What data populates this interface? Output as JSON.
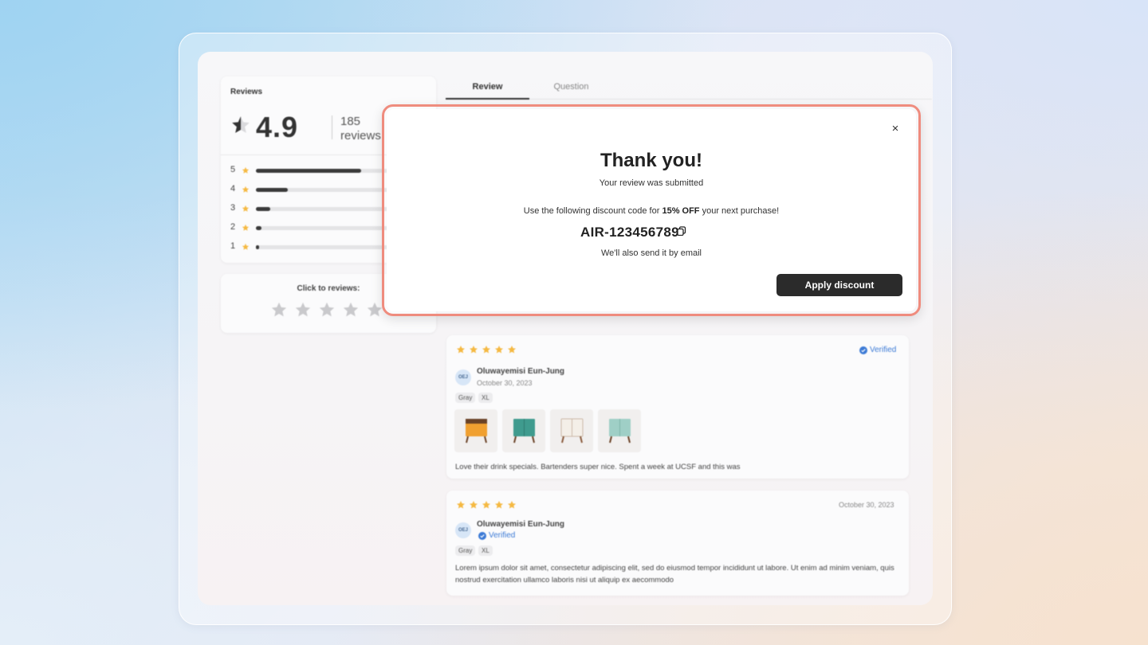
{
  "summary": {
    "title": "Reviews",
    "score": "4.9",
    "count_line1": "185",
    "count_line2": "reviews",
    "bars": [
      {
        "label": "5",
        "fraction": 0.6
      },
      {
        "label": "4",
        "fraction": 0.18
      },
      {
        "label": "3",
        "fraction": 0.08
      },
      {
        "label": "2",
        "fraction": 0.03
      },
      {
        "label": "1",
        "fraction": 0.02
      }
    ]
  },
  "click_to_review": {
    "title": "Click to reviews:"
  },
  "tabs": [
    {
      "label": "Review"
    },
    {
      "label": "Question"
    }
  ],
  "reviews": [
    {
      "verified_label": "Verified",
      "initials": "OEJ",
      "author": "Oluwayemisi Eun-Jung",
      "date": "October 30, 2023",
      "tags": [
        "Gray",
        "XL"
      ],
      "text": "Love their drink specials. Bartenders super nice. Spent a week at UCSF and this was"
    },
    {
      "date": "October 30, 2023",
      "initials": "OEJ",
      "author": "Oluwayemisi Eun-Jung",
      "verified_label": "Verified",
      "tags": [
        "Gray",
        "XL"
      ],
      "text": "Lorem ipsum dolor sit amet, consectetur adipiscing elit, sed do eiusmod tempor incididunt ut labore. Ut enim ad minim veniam, quis nostrud exercitation ullamco laboris nisi ut aliquip ex aecommodo"
    }
  ],
  "modal": {
    "close": "×",
    "title": "Thank you!",
    "subtitle": "Your review was submitted",
    "discount_prefix": "Use the following discount code for ",
    "discount_amount": "15% OFF",
    "discount_suffix": " your next purchase!",
    "code": "AIR-123456789",
    "email_note": "We'll also send it by email",
    "apply_label": "Apply discount"
  },
  "colors": {
    "accent_dark": "#2b2b2b",
    "star": "#f5b942",
    "verified": "#3d7bd6",
    "modal_outline": "#ef8c7e"
  }
}
